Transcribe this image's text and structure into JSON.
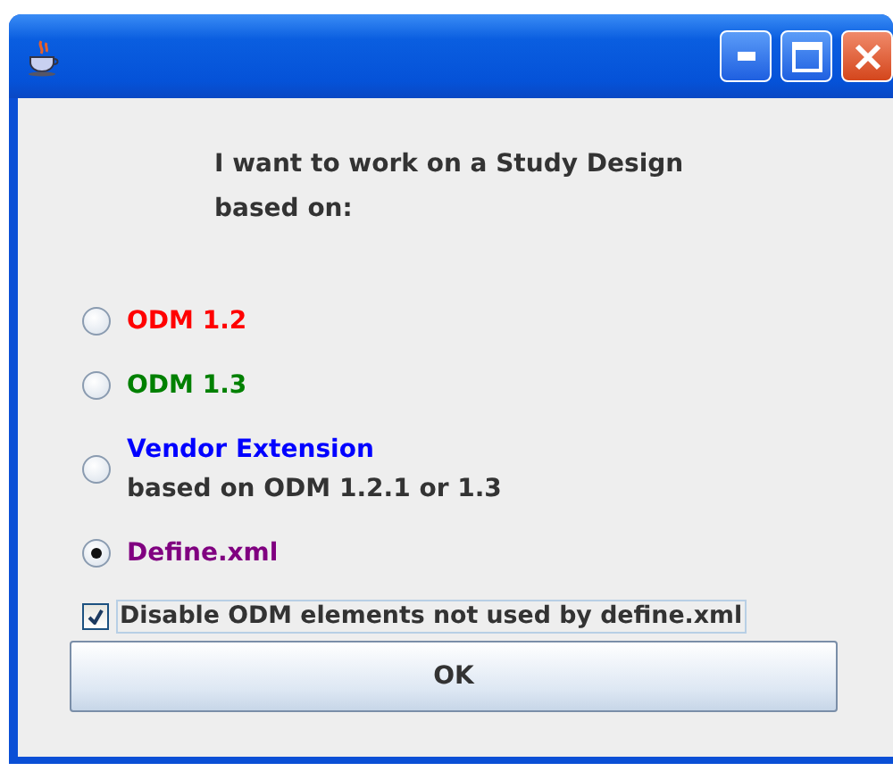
{
  "window": {
    "title_buttons": [
      {
        "kind": "minimize"
      },
      {
        "kind": "maximize"
      },
      {
        "kind": "close"
      }
    ]
  },
  "prompt": [
    "I want to work on a Study Design",
    "based on:"
  ],
  "options": [
    {
      "label": "ODM 1.2",
      "color": "#ff0000",
      "selected": false
    },
    {
      "label": "ODM 1.3",
      "color": "#008000",
      "selected": false
    },
    {
      "label": "Vendor Extension",
      "sublabel": "based on ODM 1.2.1 or 1.3",
      "color": "#0000ff",
      "selected": false
    },
    {
      "label": "Define.xml",
      "color": "#800080",
      "selected": true
    }
  ],
  "checkbox": {
    "label": "Disable ODM elements not used by define.xml",
    "checked": true
  },
  "buttons": [
    "OK"
  ]
}
